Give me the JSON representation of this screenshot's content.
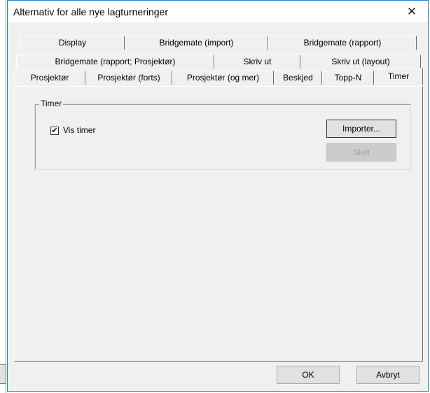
{
  "window": {
    "title": "Alternativ for alle nye lagturneringer",
    "close_symbol": "✕"
  },
  "tabs": {
    "row1": [
      "Display",
      "Bridgemate (import)",
      "Bridgemate (rapport)"
    ],
    "row2": [
      "Bridgemate (rapport; Prosjektør)",
      "Skriv ut",
      "Skriv ut (layout)"
    ],
    "row3": [
      "Prosjektør",
      "Prosjektør (forts)",
      "Prosjektør (og mer)",
      "Beskjed",
      "Topp-N",
      "Timer"
    ],
    "selected": "Timer"
  },
  "group": {
    "title": "Timer",
    "checkbox_label": "Vis timer",
    "checkbox_checked": true,
    "checkbox_mark": "✔"
  },
  "buttons": {
    "import_label": "Importer...",
    "delete_label": "Slett",
    "ok_label": "OK",
    "cancel_label": "Avbryt"
  }
}
